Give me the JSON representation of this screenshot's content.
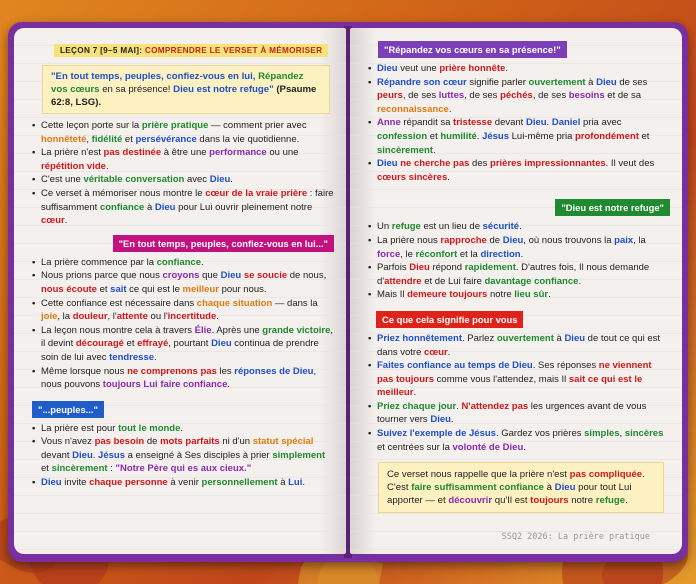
{
  "header": {
    "lesson_number": "LEÇON 7 [9–5 MAI]:",
    "lesson_title": "COMPRENDRE LE VERSET À MÉMORISER"
  },
  "memory_verse": {
    "p1": "\"En tout temps, peuples, confiez-vous en lui,",
    "p2": "Répandez vos cœurs",
    "p3": "en sa présence!",
    "p4": "Dieu est notre refuge\"",
    "p5": "(Psaume 62:8, LSG)."
  },
  "left_intro": {
    "b1": [
      "Cette leçon porte sur la ",
      "prière pratique",
      " — comment prier avec ",
      "honnêteté",
      ", ",
      "fidélité",
      " et ",
      "persévérance",
      " dans la vie quotidienne."
    ],
    "b2": [
      "La prière n'est ",
      "pas destinée",
      " à être une ",
      "performance",
      " ou une ",
      "répétition vide",
      "."
    ],
    "b3": [
      "C'est une ",
      "véritable conversation",
      " avec ",
      "Dieu",
      "."
    ],
    "b4": [
      "Ce verset à mémoriser nous montre le ",
      "cœur de la vraie prière",
      " : faire suffisamment ",
      "confiance",
      " à ",
      "Dieu",
      " pour Lui ouvrir pleinement notre ",
      "cœur",
      "."
    ]
  },
  "tag_en_tout_temps": "\"En tout temps, peuples, confiez-vous en lui...\"",
  "left_mid": {
    "b1": [
      "La prière commence par la ",
      "confiance",
      "."
    ],
    "b2": [
      "Nous prions parce que nous ",
      "croyons",
      " que ",
      "Dieu",
      " ",
      "se soucie",
      " de nous, ",
      "nous écoute",
      " et ",
      "sait",
      " ce qui est le ",
      "meilleur",
      " pour nous."
    ],
    "b3": [
      "Cette confiance est nécessaire dans ",
      "chaque situation",
      " — dans la ",
      "joie",
      ", la ",
      "douleur",
      ", l'",
      "attente",
      " ou l'",
      "incertitude",
      "."
    ],
    "b4": [
      "La leçon nous montre cela à travers ",
      "Élie",
      ". Après une ",
      "grande victoire",
      ", il devint ",
      "découragé",
      " et ",
      "effrayé",
      ", pourtant ",
      "Dieu",
      " continua de prendre soin de lui avec ",
      "tendresse",
      "."
    ],
    "b5": [
      "Même lorsque nous ",
      "ne comprenons pas",
      " les ",
      "réponses de Dieu",
      ", nous pouvons ",
      "toujours Lui faire confiance",
      "."
    ]
  },
  "tag_peuples": "\"...peuples...\"",
  "left_bottom": {
    "b1": [
      "La prière est pour ",
      "tout le monde",
      "."
    ],
    "b2": [
      "Vous n'avez ",
      "pas besoin",
      " de ",
      "mots parfaits",
      " ni d'un ",
      "statut spécial",
      " devant ",
      "Dieu",
      ". ",
      "Jésus",
      " a enseigné à Ses disciples à prier ",
      "simplement",
      " et ",
      "sincèrement",
      " : ",
      "\"Notre Père qui es aux cieux.\""
    ],
    "b3": [
      "Dieu",
      " invite ",
      "chaque personne",
      " à venir ",
      "personnellement",
      " à ",
      "Lui",
      "."
    ]
  },
  "tag_repandez": "\"Répandez vos cœurs en sa présence!\"",
  "right_top": {
    "b1": [
      "Dieu",
      " veut une ",
      "prière honnête",
      "."
    ],
    "b2": [
      "Répandre son cœur",
      " signifie parler ",
      "ouvertement",
      " à ",
      "Dieu",
      " de ses ",
      "peurs",
      ", de ses ",
      "luttes",
      ", de ses ",
      "péchés",
      ", de ses ",
      "besoins",
      " et de sa ",
      "reconnaissance",
      "."
    ],
    "b3": [
      "Anne",
      " répandit sa ",
      "tristesse",
      " devant ",
      "Dieu",
      ". ",
      "Daniel",
      " pria avec ",
      "confession",
      " et ",
      "humilité",
      ". ",
      "Jésus",
      " Lui-même pria ",
      "profondément",
      " et ",
      "sincèrement",
      "."
    ],
    "b4": [
      "Dieu",
      " ",
      "ne cherche pas",
      " des ",
      "prières impressionnantes",
      ". Il veut des ",
      "cœurs sincères",
      "."
    ]
  },
  "tag_refuge": "\"Dieu est notre refuge\"",
  "right_mid": {
    "b1": [
      "Un ",
      "refuge",
      " est un lieu de ",
      "sécurité",
      "."
    ],
    "b2": [
      "La prière nous ",
      "rapproche",
      " de ",
      "Dieu",
      ", où nous trouvons la ",
      "paix",
      ", la ",
      "force",
      ", le ",
      "réconfort",
      " et la ",
      "direction",
      "."
    ],
    "b3": [
      "Parfois ",
      "Dieu",
      " répond ",
      "rapidement",
      ". D'autres fois, Il nous demande d'",
      "attendre",
      " et de Lui faire ",
      "davantage confiance",
      "."
    ],
    "b4": [
      "Mais Il ",
      "demeure toujours",
      " notre ",
      "lieu sûr",
      "."
    ]
  },
  "tag_signifie": "Ce que cela signifie pour vous",
  "right_bottom": {
    "b1": [
      "Priez honnêtement",
      ". Parlez ",
      "ouvertement",
      " à ",
      "Dieu",
      " de tout ce qui est dans votre ",
      "cœur",
      "."
    ],
    "b2": [
      "Faites confiance au temps de Dieu",
      ". Ses réponses ",
      "ne viennent pas toujours",
      " comme vous l'attendez, mais Il ",
      "sait ce qui est le meilleur",
      "."
    ],
    "b3": [
      "Priez chaque jour",
      ". ",
      "N'attendez pas",
      " les urgences avant de vous tourner vers ",
      "Dieu",
      "."
    ],
    "b4": [
      "Suivez l'exemple de Jésus",
      ". Gardez vos prières ",
      "simples",
      ", ",
      "sincères",
      " et centrées sur la ",
      "volonté de Dieu",
      "."
    ]
  },
  "closing": [
    "Ce verset nous rappelle que la prière n'est ",
    "pas compliquée",
    ". C'est ",
    "faire suffisamment confiance",
    " à ",
    "Dieu",
    " pour tout Lui apporter — et ",
    "découvrir",
    " qu'Il est ",
    "toujours",
    " notre ",
    "refuge",
    "."
  ],
  "footer": "SSQ2 2026: La prière pratique"
}
